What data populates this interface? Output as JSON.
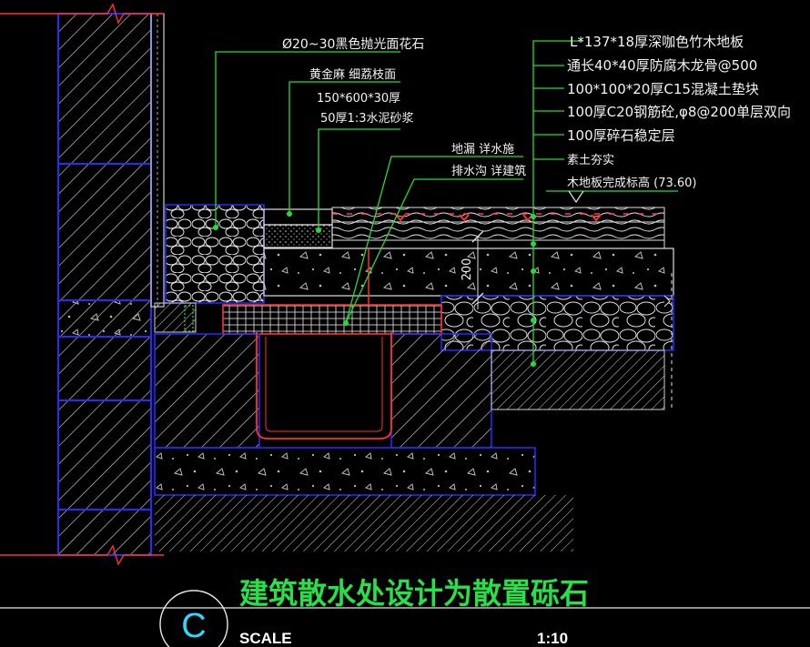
{
  "notes_left": [
    "Ø20~30黑色抛光面花石",
    "黄金麻  细荔枝面",
    "150*600*30厚",
    "50厚1:3水泥砂浆"
  ],
  "notes_center": [
    "地漏  详水施",
    "排水沟  详建筑"
  ],
  "notes_right": [
    "L*137*18厚深咖色竹木地板",
    "通长40*40厚防腐木龙骨@500",
    "100*100*20厚C15混凝土垫块",
    "100厚C20钢筋砼,φ8@200单层双向",
    "100厚碎石稳定层",
    "素土夯实",
    "木地板完成标高 (73.60)"
  ],
  "dimension": "200",
  "title_block": {
    "symbol": "C",
    "title": "建筑散水处设计为散置砾石",
    "scale_label": "SCALE",
    "scale_value": "1:10"
  },
  "colors": {
    "background": "#000000",
    "leader": "#22dd33",
    "outline": "#1a1aff",
    "hatch": "#d8d8d8",
    "drain": "#ff3030",
    "title": "#27e04a"
  }
}
